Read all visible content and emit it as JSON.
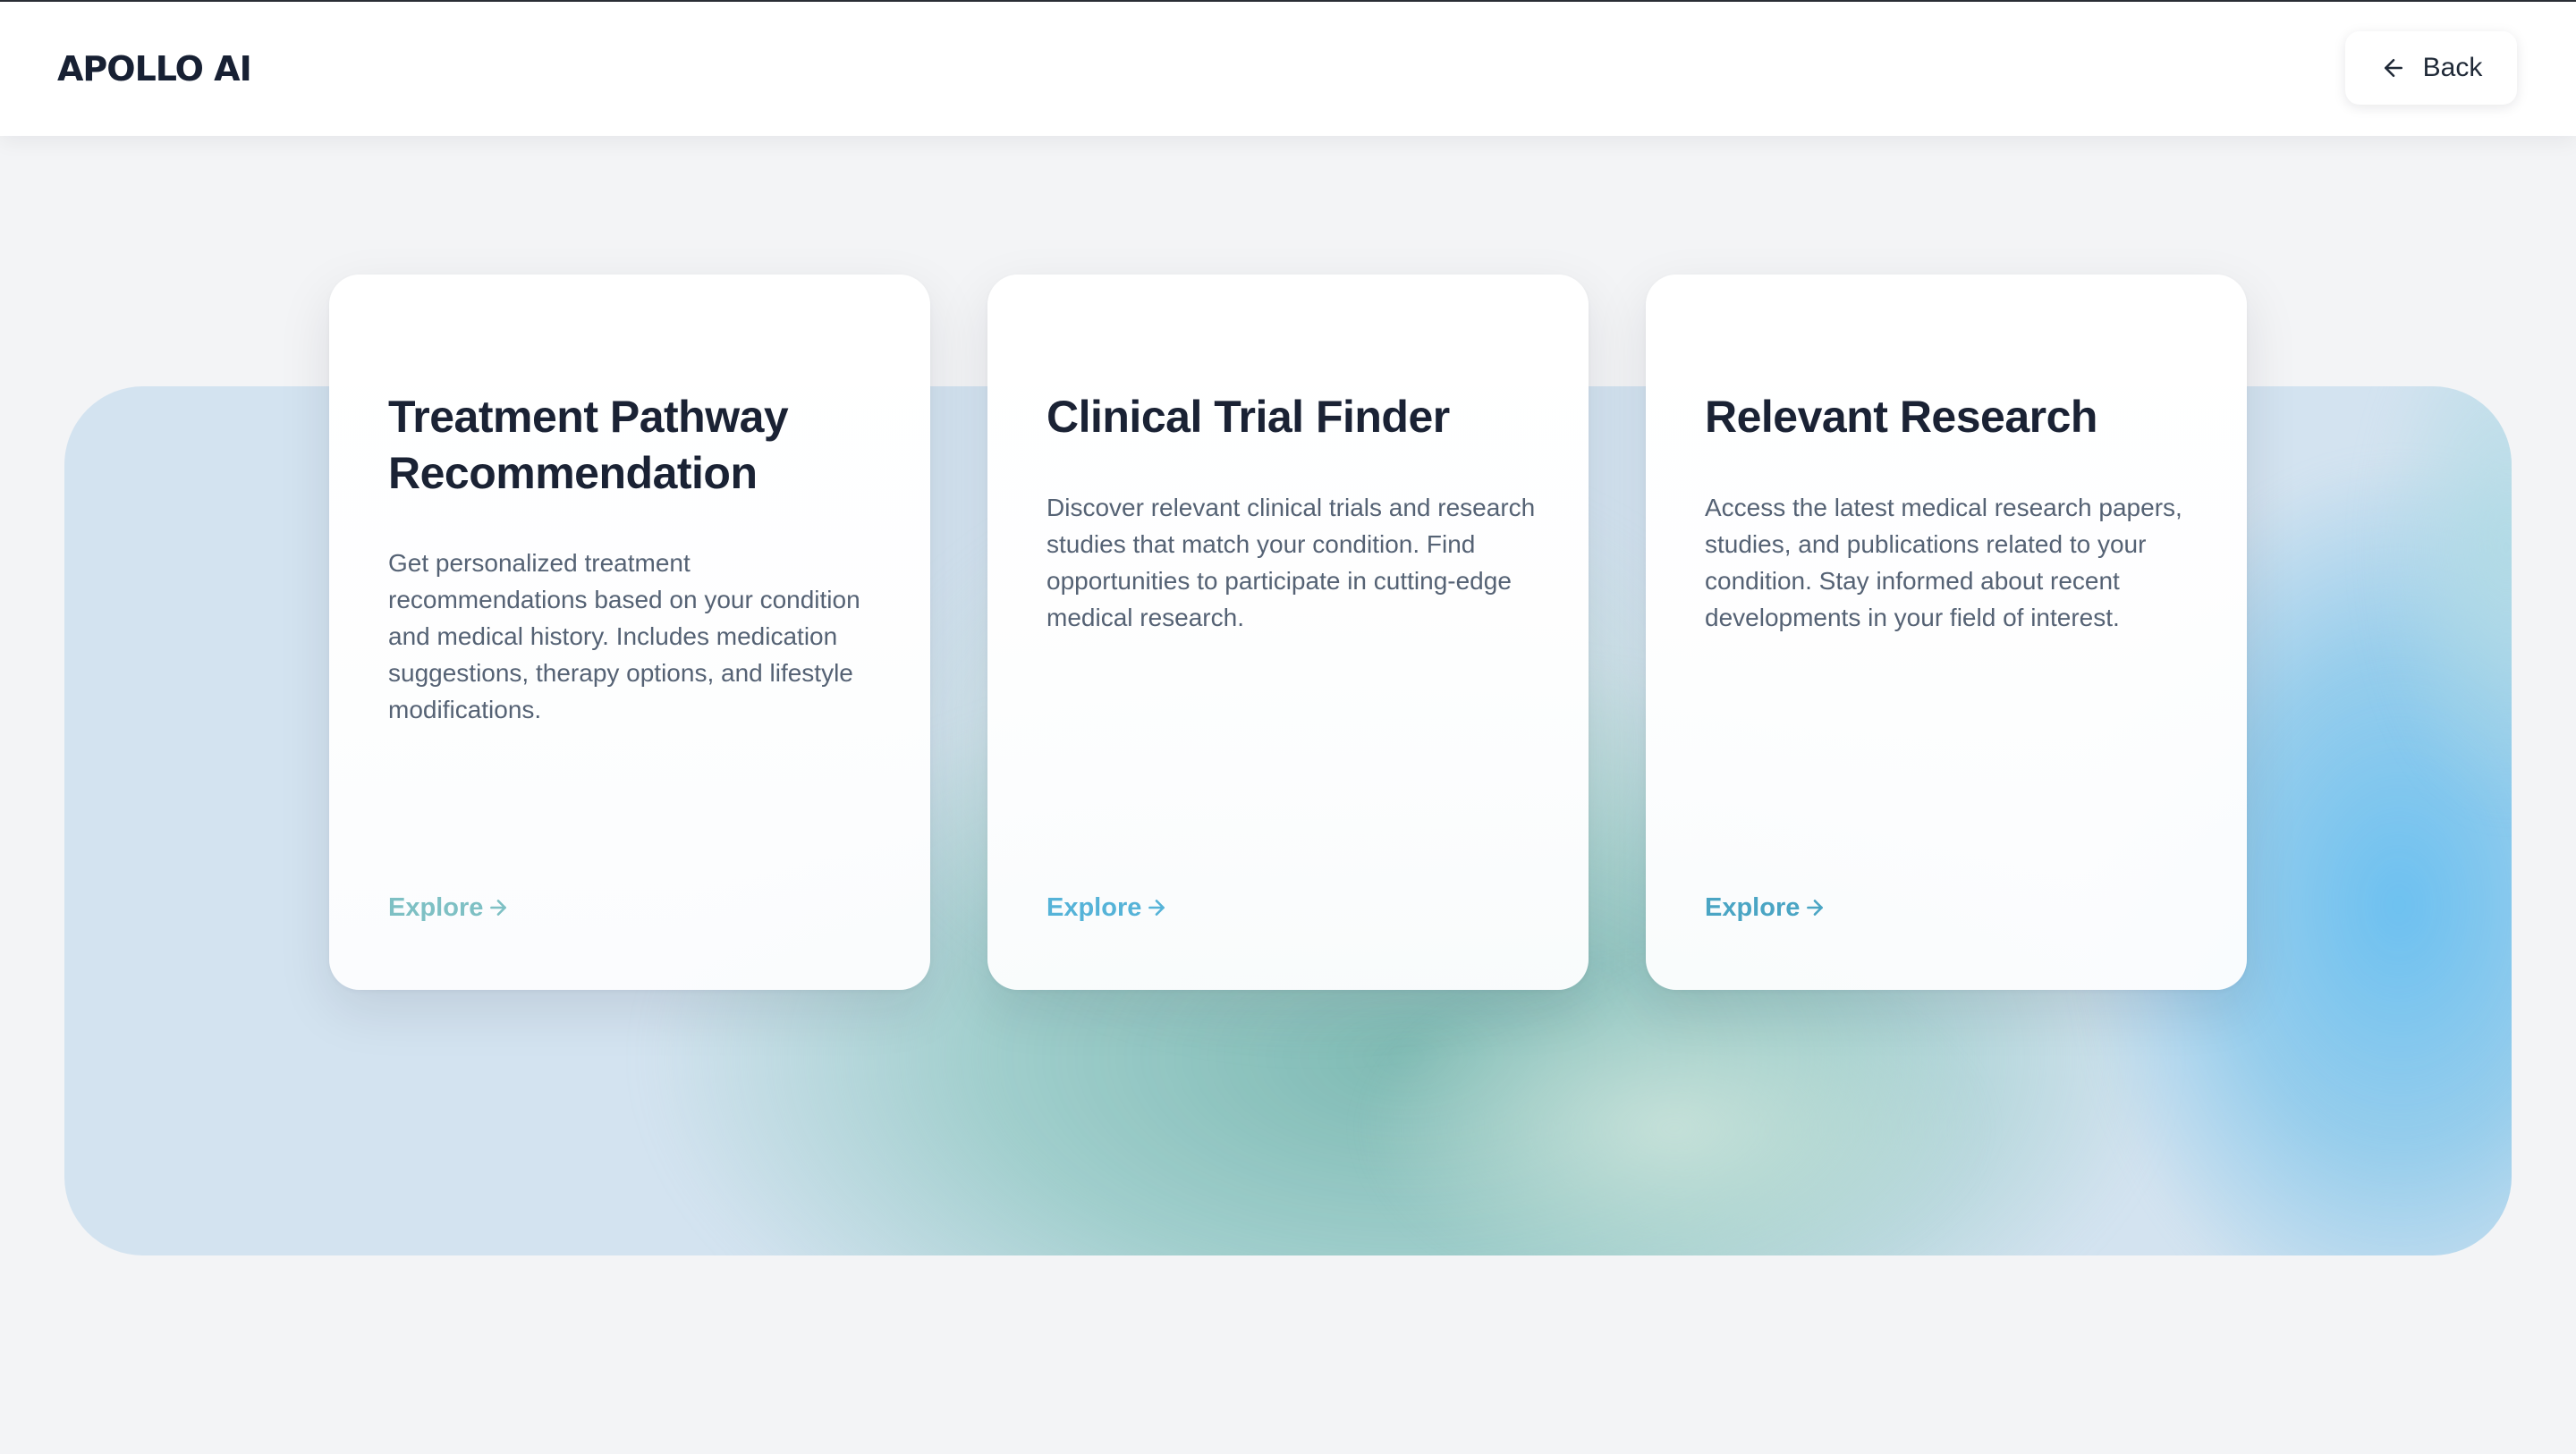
{
  "header": {
    "logo_text": "APOLLO AI",
    "back_label": "Back",
    "back_icon": "arrow-left-icon"
  },
  "cards": [
    {
      "title": "Treatment Pathway Recommendation",
      "description": "Get personalized treatment recommendations based on your condition and medical history. Includes medication suggestions, therapy options, and lifestyle modifications.",
      "link_label": "Explore",
      "link_icon": "arrow-right-icon",
      "link_color": "#7ec0c4"
    },
    {
      "title": "Clinical Trial Finder",
      "description": "Discover relevant clinical trials and research studies that match your condition. Find opportunities to participate in cutting-edge medical research.",
      "link_label": "Explore",
      "link_icon": "arrow-right-icon",
      "link_color": "#55b3d8"
    },
    {
      "title": "Relevant Research",
      "description": "Access the latest medical research papers, studies, and publications related to your condition. Stay informed about recent developments in your field of interest.",
      "link_label": "Explore",
      "link_icon": "arrow-right-icon",
      "link_color": "#4aa5c4"
    }
  ],
  "colors": {
    "page_background": "#f3f4f6",
    "text_dark": "#1a2234",
    "text_muted": "#556274",
    "banner_blue": "#d3e3f0",
    "banner_teal": "#8fc7c0",
    "banner_sky": "#6cc0f0"
  }
}
